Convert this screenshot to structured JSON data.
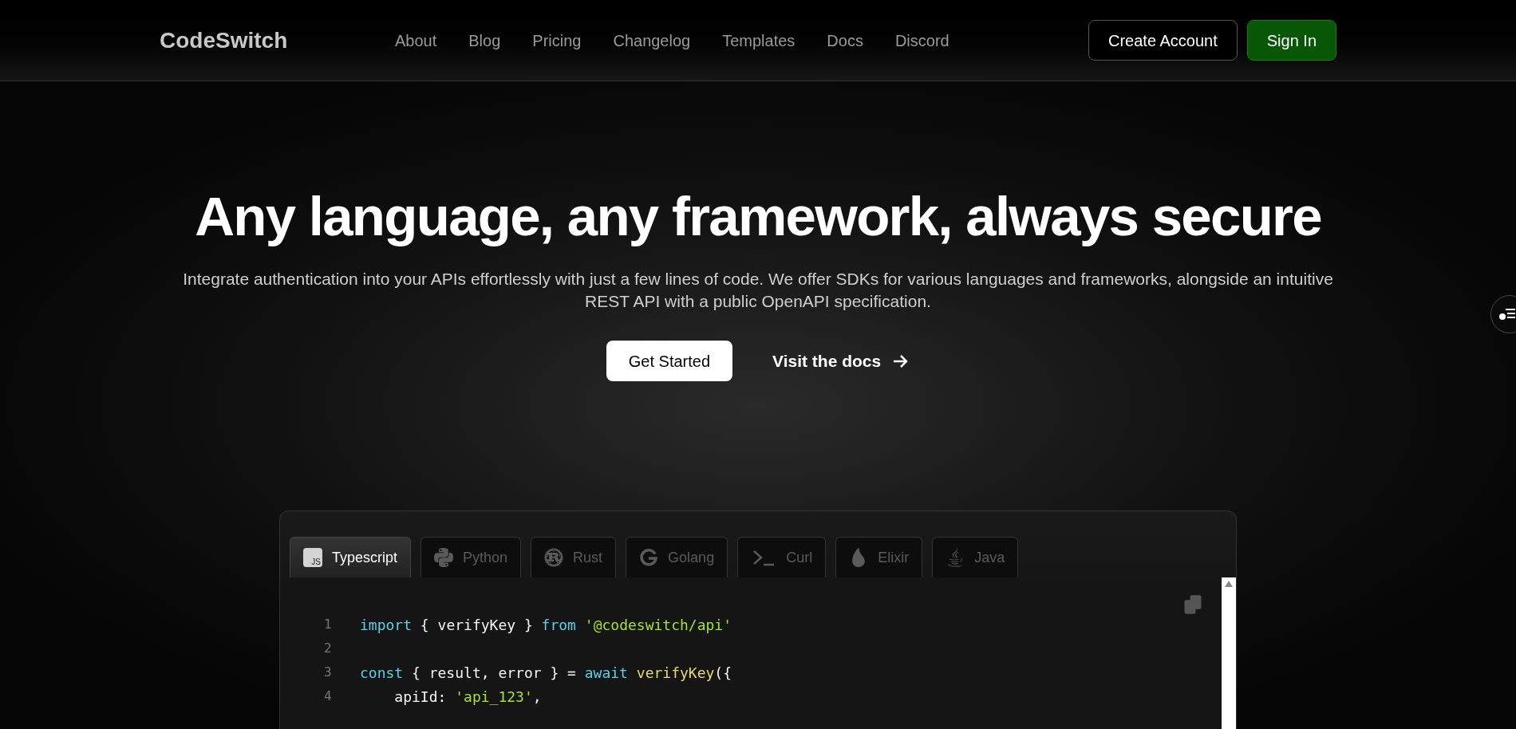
{
  "header": {
    "logo": "CodeSwitch",
    "nav": [
      "About",
      "Blog",
      "Pricing",
      "Changelog",
      "Templates",
      "Docs",
      "Discord"
    ],
    "create_account": "Create Account",
    "sign_in": "Sign In"
  },
  "hero": {
    "title": "Any language, any framework, always secure",
    "subtitle": "Integrate authentication into your APIs effortlessly with just a few lines of code. We offer SDKs for various languages and frameworks, alongside an intuitive REST API with a public OpenAPI specification.",
    "primary_button": "Get Started",
    "secondary_link": "Visit the docs"
  },
  "code_card": {
    "tabs": [
      {
        "label": "Typescript",
        "selected": true,
        "icon_text": "JS"
      },
      {
        "label": "Python",
        "selected": false
      },
      {
        "label": "Rust",
        "selected": false
      },
      {
        "label": "Golang",
        "selected": false
      },
      {
        "label": "Curl",
        "selected": false
      },
      {
        "label": "Elixir",
        "selected": false
      },
      {
        "label": "Java",
        "selected": false
      }
    ],
    "lines": [
      {
        "number": "1",
        "tokens": [
          {
            "kind": "keyword",
            "text": "import"
          },
          {
            "kind": "plain",
            "text": " { verifyKey } "
          },
          {
            "kind": "keyword",
            "text": "from"
          },
          {
            "kind": "string",
            "text": " '@codeswitch/api'"
          }
        ]
      },
      {
        "number": "2"
      },
      {
        "number": "3",
        "tokens": [
          {
            "kind": "keyword",
            "text": "const"
          },
          {
            "kind": "plain",
            "text": " { result, error } = "
          },
          {
            "kind": "keyword",
            "text": "await"
          },
          {
            "kind": "function",
            "text": " verifyKey"
          },
          {
            "kind": "plain",
            "text": "({"
          }
        ]
      },
      {
        "number": "4",
        "tokens": [
          {
            "kind": "plain",
            "text": "    apiId: "
          },
          {
            "kind": "string",
            "text": "'api_123'"
          },
          {
            "kind": "plain",
            "text": ","
          }
        ]
      }
    ]
  }
}
